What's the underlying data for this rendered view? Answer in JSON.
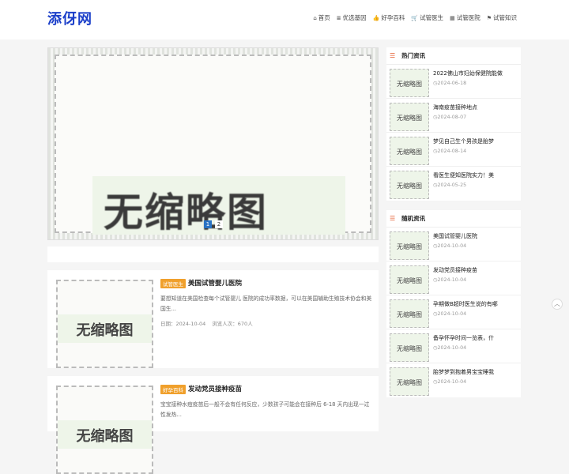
{
  "site": {
    "logo": "添伢网"
  },
  "nav": [
    {
      "icon": "home-icon",
      "glyph": "⌂",
      "label": "首页"
    },
    {
      "icon": "list-icon",
      "glyph": "≣",
      "label": "优选基因"
    },
    {
      "icon": "thumbs-up-icon",
      "glyph": "👍",
      "label": "好孕百科"
    },
    {
      "icon": "cart-icon",
      "glyph": "🛒",
      "label": "试管医生"
    },
    {
      "icon": "grid-icon",
      "glyph": "▦",
      "label": "试管医院"
    },
    {
      "icon": "flag-icon",
      "glyph": "⚑",
      "label": "试管知识"
    }
  ],
  "slider": {
    "placeholder": "无缩略图",
    "dots": [
      "1",
      "2"
    ],
    "active_index": 0
  },
  "posts": [
    {
      "tag": "试管医生",
      "title": "美国试管婴儿医院",
      "excerpt": "要想知道在美国检查每个试管婴儿 医院的成功率数据，可以在美国辅助生殖技术协会和美国生...",
      "date": "日期：2024-10-04",
      "views": "浏览人次：670人",
      "thumb": "无缩略图"
    },
    {
      "tag": "好孕百科",
      "title": "发动党员接种疫苗",
      "excerpt": "宝宝接种水痘疫苗后一般不会有任何反应，少数孩子可能会在接种后 6-18 天内出现一过性发热...",
      "date": "",
      "views": "",
      "thumb": "无缩略图"
    }
  ],
  "hot": {
    "heading": "热门资讯",
    "items": [
      {
        "title": "2022佛山市妇幼保健院能做",
        "date": "2024-06-18",
        "thumb": "无缩略图"
      },
      {
        "title": "海南疫苗接种地点",
        "date": "2024-08-07",
        "thumb": "无缩略图"
      },
      {
        "title": "梦见自己生个男孩是胎梦",
        "date": "2024-08-14",
        "thumb": "无缩略图"
      },
      {
        "title": "看医生便知医院实力！美",
        "date": "2024-05-25",
        "thumb": "无缩略图"
      }
    ]
  },
  "random": {
    "heading": "随机资讯",
    "items": [
      {
        "title": "美国试管婴儿医院",
        "date": "2024-10-04",
        "thumb": "无缩略图"
      },
      {
        "title": "发动党员接种疫苗",
        "date": "2024-10-04",
        "thumb": "无缩略图"
      },
      {
        "title": "孕期做B超时医生说的有哪",
        "date": "2024-10-04",
        "thumb": "无缩略图"
      },
      {
        "title": "备孕怀孕时间一览表，什",
        "date": "2024-10-04",
        "thumb": "无缩略图"
      },
      {
        "title": "胎梦梦到抱着男宝宝睡我",
        "date": "2024-10-04",
        "thumb": "无缩略图"
      }
    ]
  },
  "backtop": "︿"
}
